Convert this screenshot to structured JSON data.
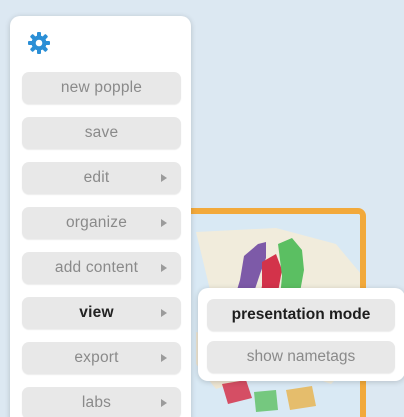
{
  "menu": {
    "items": [
      {
        "label": "new popple",
        "has_submenu": false
      },
      {
        "label": "save",
        "has_submenu": false
      },
      {
        "label": "edit",
        "has_submenu": true
      },
      {
        "label": "organize",
        "has_submenu": true
      },
      {
        "label": "add content",
        "has_submenu": true
      },
      {
        "label": "view",
        "has_submenu": true,
        "active": true
      },
      {
        "label": "export",
        "has_submenu": true
      },
      {
        "label": "labs",
        "has_submenu": true
      }
    ]
  },
  "submenu": {
    "items": [
      {
        "label": "presentation mode"
      },
      {
        "label": "show nametags"
      }
    ]
  },
  "icons": {
    "gear": "gear-icon",
    "submenu_arrow": "triangle-right-icon"
  },
  "colors": {
    "accent_blue": "#2b8fd6",
    "map_card_border": "#f2a93b",
    "canvas_bg": "#dce8f2",
    "button_bg": "#e8e8e8"
  }
}
